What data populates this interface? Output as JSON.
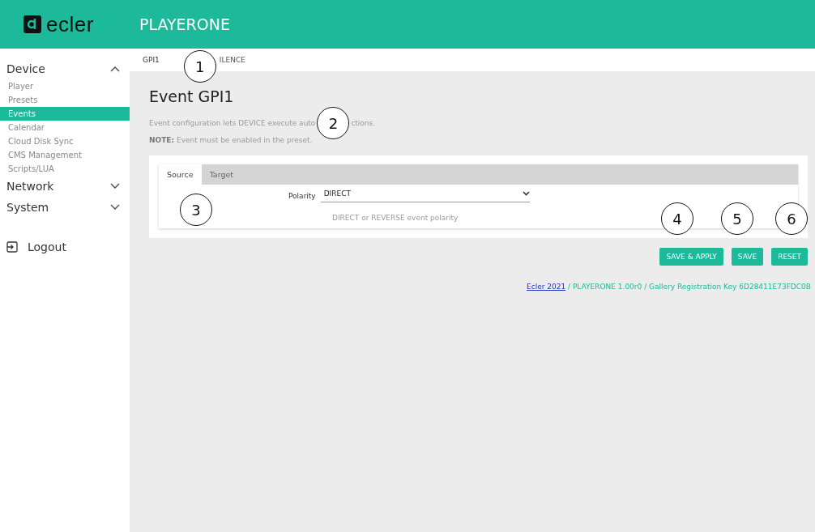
{
  "header": {
    "logo": "ecler",
    "title": "PLAYERONE"
  },
  "sidebar": {
    "sections": [
      {
        "label": "Device",
        "expanded": true,
        "items": [
          {
            "label": "Player",
            "selected": false
          },
          {
            "label": "Presets",
            "selected": false
          },
          {
            "label": "Events",
            "selected": true
          },
          {
            "label": "Calendar",
            "selected": false
          },
          {
            "label": "Cloud Disk Sync",
            "selected": false
          },
          {
            "label": "CMS Management",
            "selected": false
          },
          {
            "label": "Scripts/LUA",
            "selected": false
          }
        ]
      },
      {
        "label": "Network",
        "expanded": false
      },
      {
        "label": "System",
        "expanded": false
      }
    ],
    "logout": "Logout"
  },
  "subtabs": [
    {
      "label": "GPI1",
      "selected": true
    },
    {
      "label": "ILENCE",
      "selected": false
    }
  ],
  "page": {
    "title": "Event GPI1",
    "description_start": "Event configuration lets DEVICE execute auto",
    "description_end": "ctions.",
    "note_label": "NOTE:",
    "note": "Event must be enabled in the preset."
  },
  "card": {
    "tabs": [
      {
        "label": "Source",
        "selected": true
      },
      {
        "label": "Target",
        "selected": false
      }
    ],
    "field": {
      "label": "Polarity",
      "value": "DIRECT",
      "hint": "DIRECT or REVERSE event polarity"
    }
  },
  "buttons": [
    "SAVE & APPLY",
    "SAVE",
    "RESET"
  ],
  "footer": {
    "link": "Ecler 2021",
    "text": " / PLAYERONE 1.00r0 / Gallery Registration Key 6D28411E73FDC0B"
  },
  "callouts": [
    "1",
    "2",
    "3",
    "4",
    "5",
    "6"
  ]
}
